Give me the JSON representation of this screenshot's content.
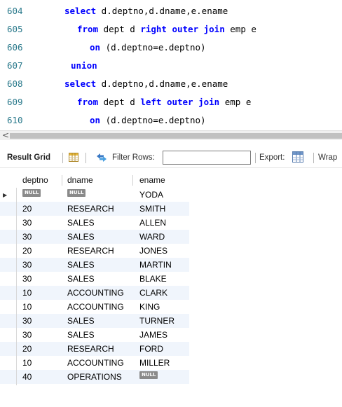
{
  "editor": {
    "lines": [
      {
        "num": "604",
        "indent": 92,
        "parts": [
          {
            "t": "select",
            "k": true
          },
          {
            "t": " d.deptno,d.dname,e.ename",
            "k": false
          }
        ]
      },
      {
        "num": "605",
        "indent": 110,
        "parts": [
          {
            "t": "from",
            "k": true
          },
          {
            "t": " dept d ",
            "k": false
          },
          {
            "t": "right outer join",
            "k": true
          },
          {
            "t": " emp e",
            "k": false
          }
        ]
      },
      {
        "num": "606",
        "indent": 128,
        "parts": [
          {
            "t": "on",
            "k": true
          },
          {
            "t": " (d.deptno=e.deptno)",
            "k": false
          }
        ]
      },
      {
        "num": "607",
        "indent": 101,
        "parts": [
          {
            "t": "union",
            "k": true
          }
        ]
      },
      {
        "num": "608",
        "indent": 92,
        "parts": [
          {
            "t": "select",
            "k": true
          },
          {
            "t": " d.deptno,d.dname,e.ename",
            "k": false
          }
        ]
      },
      {
        "num": "609",
        "indent": 110,
        "parts": [
          {
            "t": "from",
            "k": true
          },
          {
            "t": " dept d ",
            "k": false
          },
          {
            "t": "left outer join",
            "k": true
          },
          {
            "t": " emp e",
            "k": false
          }
        ]
      },
      {
        "num": "610",
        "indent": 128,
        "parts": [
          {
            "t": "on",
            "k": true
          },
          {
            "t": " (d.deptno=e.deptno)",
            "k": false
          }
        ]
      }
    ]
  },
  "scrollbar": {
    "left_arrow": "<"
  },
  "toolbar": {
    "result_grid_label": "Result Grid",
    "filter_rows_label": "Filter Rows:",
    "filter_rows_value": "",
    "export_label": "Export:",
    "wrap_label": "Wrap"
  },
  "grid": {
    "columns": [
      "deptno",
      "dname",
      "ename"
    ],
    "null_label": "NULL",
    "rows": [
      {
        "deptno": null,
        "dname": null,
        "ename": "YODA"
      },
      {
        "deptno": "20",
        "dname": "RESEARCH",
        "ename": "SMITH"
      },
      {
        "deptno": "30",
        "dname": "SALES",
        "ename": "ALLEN"
      },
      {
        "deptno": "30",
        "dname": "SALES",
        "ename": "WARD"
      },
      {
        "deptno": "20",
        "dname": "RESEARCH",
        "ename": "JONES"
      },
      {
        "deptno": "30",
        "dname": "SALES",
        "ename": "MARTIN"
      },
      {
        "deptno": "30",
        "dname": "SALES",
        "ename": "BLAKE"
      },
      {
        "deptno": "10",
        "dname": "ACCOUNTING",
        "ename": "CLARK"
      },
      {
        "deptno": "10",
        "dname": "ACCOUNTING",
        "ename": "KING"
      },
      {
        "deptno": "30",
        "dname": "SALES",
        "ename": "TURNER"
      },
      {
        "deptno": "30",
        "dname": "SALES",
        "ename": "JAMES"
      },
      {
        "deptno": "20",
        "dname": "RESEARCH",
        "ename": "FORD"
      },
      {
        "deptno": "10",
        "dname": "ACCOUNTING",
        "ename": "MILLER"
      },
      {
        "deptno": "40",
        "dname": "OPERATIONS",
        "ename": null
      }
    ]
  },
  "colors": {
    "keyword": "#0000ff",
    "line_number": "#2b7a8c",
    "alt_row": "#f0f5fc",
    "null_badge": "#8a8a8a"
  },
  "icons": {
    "grid": "grid-icon",
    "filter": "filter-arrows-icon",
    "export": "export-table-icon",
    "row_pointer": "row-pointer-icon"
  }
}
